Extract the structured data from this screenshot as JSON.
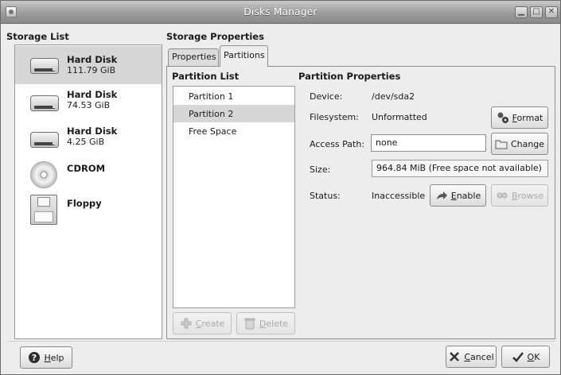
{
  "window": {
    "title": "Disks Manager",
    "controls": [
      "minimize",
      "maximize",
      "close"
    ]
  },
  "storage": {
    "header": "Storage List",
    "devices": [
      {
        "name": "Hard Disk",
        "size": "111.79 GiB",
        "icon": "hard-disk-icon",
        "selected": true
      },
      {
        "name": "Hard Disk",
        "size": "74.53 GiB",
        "icon": "hard-disk-icon",
        "selected": false
      },
      {
        "name": "Hard Disk",
        "size": "4.25 GiB",
        "icon": "hard-disk-icon",
        "selected": false
      },
      {
        "name": "CDROM",
        "size": "",
        "icon": "cdrom-icon",
        "selected": false
      },
      {
        "name": "Floppy",
        "size": "",
        "icon": "floppy-icon",
        "selected": false
      }
    ]
  },
  "properties": {
    "header": "Storage Properties",
    "tabs": [
      {
        "label": "Properties",
        "active": false
      },
      {
        "label": "Partitions",
        "active": true
      }
    ]
  },
  "partitions": {
    "list_header": "Partition List",
    "items": [
      {
        "label": "Partition 1",
        "selected": false
      },
      {
        "label": "Partition 2",
        "selected": true
      },
      {
        "label": "Free Space",
        "selected": false
      }
    ],
    "create_btn": {
      "pre": "",
      "u": "C",
      "post": "reate",
      "icon": "plus-icon",
      "enabled": false
    },
    "delete_btn": {
      "pre": "",
      "u": "D",
      "post": "elete",
      "icon": "trash-icon",
      "enabled": false
    }
  },
  "partition_props": {
    "header": "Partition Properties",
    "device_label": "Device:",
    "device_value": "/dev/sda2",
    "fs_label": "Filesystem:",
    "fs_value": "Unformatted",
    "format_btn": {
      "pre": "",
      "u": "F",
      "post": "ormat",
      "icon": "format-icon"
    },
    "path_label": "Access Path:",
    "path_value": "none",
    "change_btn": {
      "label": "Change",
      "icon": "folder-icon"
    },
    "size_label": "Size:",
    "size_value": "964.84 MiB (Free space not available)",
    "status_label": "Status:",
    "status_value": "Inaccessible",
    "enable_btn": {
      "pre": "",
      "u": "E",
      "post": "nable",
      "icon": "arrow-icon"
    },
    "browse_btn": {
      "pre": "",
      "u": "B",
      "post": "rowse",
      "icon": "browse-icon",
      "enabled": false
    }
  },
  "footer": {
    "help_btn": {
      "pre": "",
      "u": "H",
      "post": "elp",
      "icon": "help-icon"
    },
    "cancel_btn": {
      "pre": "",
      "u": "C",
      "post": "ancel",
      "icon": "cancel-icon"
    },
    "ok_btn": {
      "pre": "",
      "u": "O",
      "post": "K",
      "icon": "ok-icon"
    }
  }
}
